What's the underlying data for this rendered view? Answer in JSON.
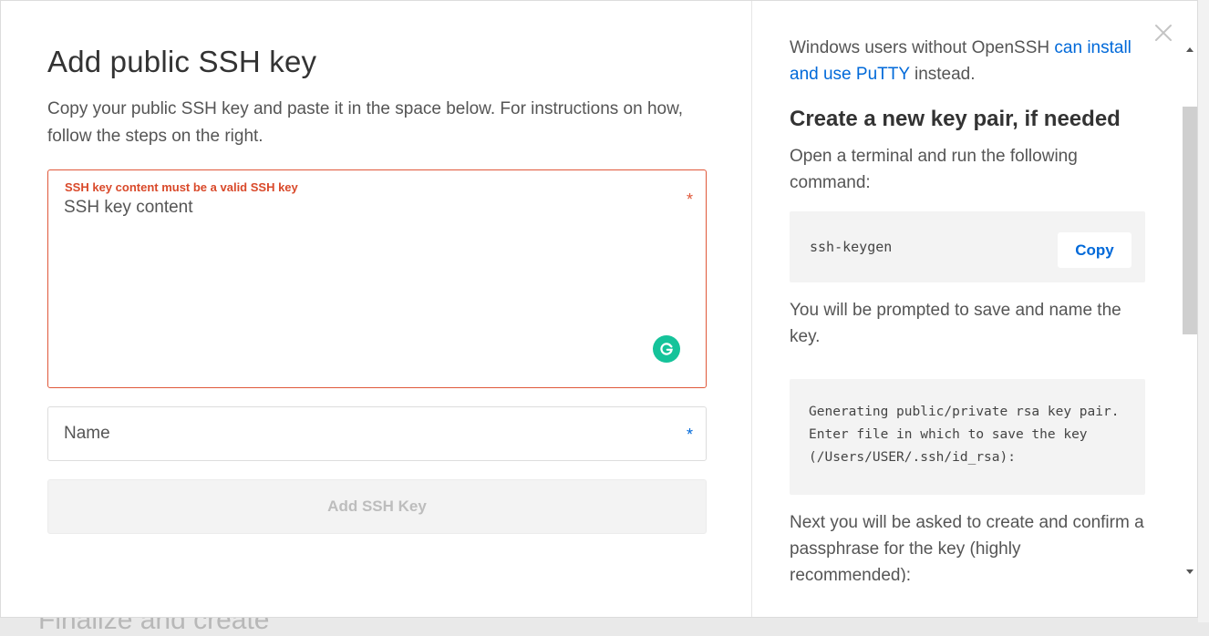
{
  "backdrop": {
    "text": "Finalize and create"
  },
  "modal": {
    "title": "Add public SSH key",
    "intro": "Copy your public SSH key and paste it in the space below. For instructions on how, follow the steps on the right.",
    "ssh_field": {
      "error": "SSH key content must be a valid SSH key",
      "placeholder": "SSH key content",
      "required_marker": "*"
    },
    "name_field": {
      "placeholder": "Name",
      "required_marker": "*"
    },
    "submit_label": "Add SSH Key",
    "close_icon": "close-icon",
    "grammarly_icon": "grammarly-icon",
    "grammarly_color": "#15c39a",
    "error_color": "#d9492a",
    "link_color": "#0069d9"
  },
  "instructions": {
    "windows_prefix": "Windows users without OpenSSH ",
    "windows_link": "can install and use PuTTY",
    "windows_suffix": " instead.",
    "heading": "Create a new key pair, if needed",
    "step1": "Open a terminal and run the following command:",
    "command": "ssh-keygen",
    "copy_label": "Copy",
    "step2": "You will be prompted to save and name the key.",
    "output": "Generating public/private rsa key pair. Enter file in which to save the key (/Users/USER/.ssh/id_rsa):",
    "step3": "Next you will be asked to create and confirm a passphrase for the key (highly recommended):"
  }
}
